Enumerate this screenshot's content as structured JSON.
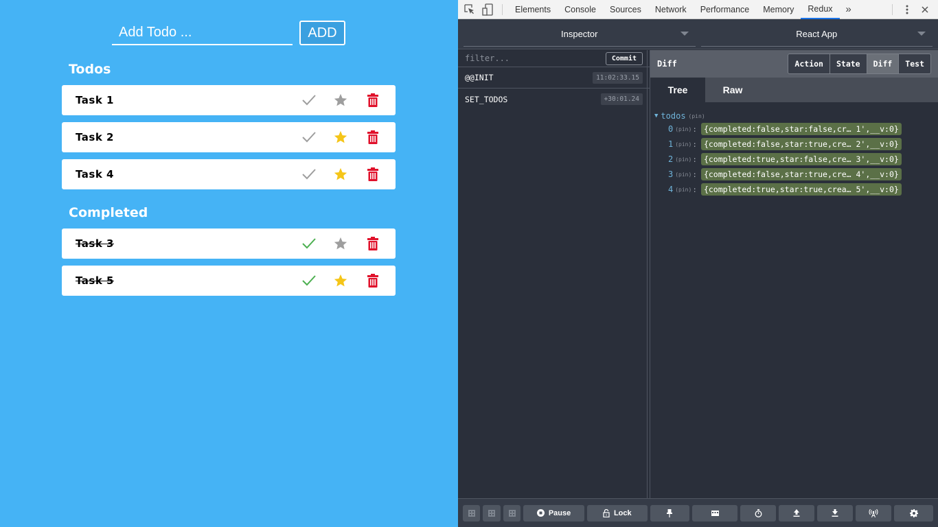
{
  "app": {
    "add_input_placeholder": "Add Todo ...",
    "add_button_label": "ADD",
    "sections": {
      "todos_title": "Todos",
      "completed_title": "Completed"
    },
    "todos": [
      {
        "label": "Task 1",
        "completed": false,
        "starred": false
      },
      {
        "label": "Task 2",
        "completed": false,
        "starred": true
      },
      {
        "label": "Task 4",
        "completed": false,
        "starred": true
      }
    ],
    "completed": [
      {
        "label": "Task 3",
        "completed": true,
        "starred": false
      },
      {
        "label": "Task 5",
        "completed": true,
        "starred": true
      }
    ],
    "colors": {
      "background": "#45b3f5",
      "check_inactive": "#9e9e9e",
      "check_done": "#4caf50",
      "star_off": "#9e9e9e",
      "star_on": "#f5c518",
      "trash": "#e0112b"
    }
  },
  "devtools": {
    "tabs": [
      "Elements",
      "Console",
      "Sources",
      "Network",
      "Performance",
      "Memory",
      "Redux"
    ],
    "active_tab": "Redux",
    "more_tabs_icon": "double-chevron-right",
    "monitor_select": "Inspector",
    "instance_select": "React App",
    "filter_placeholder": "filter...",
    "commit_label": "Commit",
    "actions": [
      {
        "name": "@@INIT",
        "time": "11:02:33.15"
      },
      {
        "name": "SET_TODOS",
        "time": "+30:01.24"
      }
    ],
    "state_header_title": "Diff",
    "view_tabs": [
      "Action",
      "State",
      "Diff",
      "Test"
    ],
    "active_view_tab": "Diff",
    "sub_tabs": [
      "Tree",
      "Raw"
    ],
    "active_sub_tab": "Tree",
    "tree": {
      "root_key": "todos",
      "pin_label": "(pin)",
      "items": [
        {
          "key": "0",
          "value": "{completed:false,star:false,cr… 1',__v:0}"
        },
        {
          "key": "1",
          "value": "{completed:false,star:true,cre… 2',__v:0}"
        },
        {
          "key": "2",
          "value": "{completed:true,star:false,cre… 3',__v:0}"
        },
        {
          "key": "3",
          "value": "{completed:false,star:true,cre… 4',__v:0}"
        },
        {
          "key": "4",
          "value": "{completed:true,star:true,crea… 5',__v:0}"
        }
      ]
    },
    "bottom_bar": {
      "pause_label": "Pause",
      "lock_label": "Lock"
    }
  }
}
